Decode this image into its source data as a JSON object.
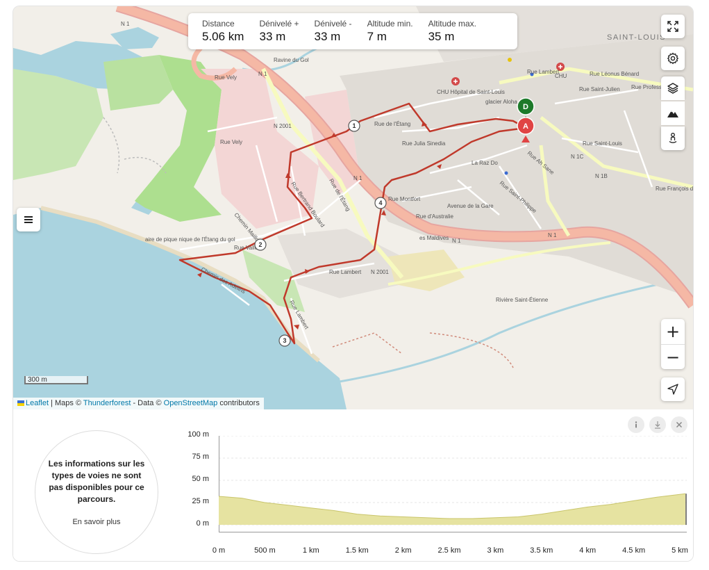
{
  "stats": [
    {
      "label": "Distance",
      "value": "5.06 km"
    },
    {
      "label": "Dénivelé +",
      "value": "33 m"
    },
    {
      "label": "Dénivelé -",
      "value": "33 m"
    },
    {
      "label": "Altitude min.",
      "value": "7 m"
    },
    {
      "label": "Altitude max.",
      "value": "35 m"
    }
  ],
  "map": {
    "controls": [
      "fullscreen-icon",
      "gear-icon",
      "layers-icon",
      "mountain-icon",
      "pegman-icon",
      "menu-icon",
      "locate-arrow-icon"
    ],
    "zoom_in": "+",
    "zoom_out": "−",
    "scale": "300 m",
    "attribution": {
      "leaflet": "Leaflet",
      "maps": " | Maps © ",
      "thunderforest": "Thunderforest",
      "data": " - Data © ",
      "osm": "OpenStreetMap",
      "contributors": " contributors"
    },
    "markers": {
      "start": "D",
      "end": "A"
    },
    "waypoints": [
      "1",
      "2",
      "3",
      "4"
    ],
    "labels": {
      "n1_a": "N 1",
      "n1_b": "N 1",
      "n1_c": "N 1",
      "n1_d": "N 1",
      "n1_e": "N 1",
      "n2001_a": "N 2001",
      "n2001_b": "N 2001",
      "n1c": "N 1C",
      "n1b": "N 1B",
      "saint_louis": "SAINT-LOUIS",
      "rue_lambert_1": "Rue Lambert",
      "rue_lambert_2": "Rue Lambert",
      "rue_lambert_3": "Rue Lambert",
      "rue_vely_1": "Rue Vely",
      "rue_vely_2": "Rue Vely",
      "rue_letang_1": "Rue de l'Étang",
      "rue_letang_2": "Rue de l'Étang",
      "rue_julia": "Rue Julia Sinedia",
      "rue_bertrand": "Rue Bertrand Boulard",
      "rue_maillot": "Chemin Maillot",
      "rue_vallon": "Rue Vallon",
      "ch_adelins": "Chemin des Adelins",
      "rue_montfort": "Rue Montfort",
      "rue_australie": "Rue d'Australie",
      "av_gare": "Avenue de la Gare",
      "rue_st_philippe": "Rue Saint-Philippe",
      "rue_st_louis": "Rue Saint-Louis",
      "rue_ah_sane": "Rue Ah Sane",
      "rue_maldives": "es Maldives",
      "rue_st_etienne": "Rivière Saint-Étienne",
      "rue_leonus": "Rue Léonus Bénard",
      "rue_julien": "Rue Saint-Julien",
      "rue_francois": "Rue François de Mahy",
      "rue_profs": "Rue Professeur",
      "chu": "CHU",
      "chu_hopital": "CHU Hôpital de Saint-Louis",
      "glacier": "glacier Aloha",
      "la_raz": "La Raz Do",
      "aire_pique": "aire de pique nique de l'Étang du gol",
      "ravine": "Ravine du Gol"
    }
  },
  "elevation": {
    "info_message": "Les informations sur les types de voies ne sont pas disponibles pour ce parcours.",
    "learn_more": "En savoir plus",
    "buttons": [
      "info-icon",
      "download-icon",
      "close-icon"
    ],
    "y_ticks": [
      "100 m",
      "75 m",
      "50 m",
      "25 m",
      "0 m"
    ],
    "x_ticks": [
      "0 m",
      "500 m",
      "1 km",
      "1.5 km",
      "2 km",
      "2.5 km",
      "3 km",
      "3.5 km",
      "4 km",
      "4.5 km",
      "5 km"
    ]
  },
  "chart_data": {
    "type": "area",
    "x": [
      0,
      0.25,
      0.5,
      0.75,
      1.0,
      1.25,
      1.5,
      1.75,
      2.0,
      2.25,
      2.5,
      2.75,
      3.0,
      3.25,
      3.5,
      3.75,
      4.0,
      4.25,
      4.5,
      4.75,
      5.06
    ],
    "y": [
      32,
      30,
      25,
      22,
      19,
      16,
      12,
      10,
      9,
      8,
      7,
      7,
      8,
      9,
      12,
      16,
      20,
      23,
      27,
      31,
      35
    ],
    "xlabel": "",
    "ylabel": "",
    "xlim": [
      0,
      5.06
    ],
    "ylim": [
      0,
      100
    ],
    "x_unit": "km",
    "y_unit": "m",
    "fill_color": "#e6e3a1",
    "stroke_color": "#c9c56b",
    "grid": true
  }
}
